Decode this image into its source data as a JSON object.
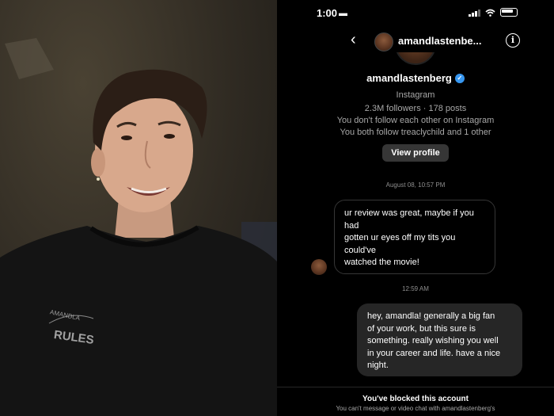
{
  "status_bar": {
    "time": "1:00",
    "car_icon": "car-icon",
    "signal_icon": "cellular-signal-icon",
    "wifi_icon": "wifi-icon",
    "battery_icon": "battery-icon"
  },
  "header": {
    "back_icon": "chevron-left-icon",
    "username": "amandlastenbe...",
    "info_icon": "info-icon"
  },
  "profile": {
    "username": "amandlastenberg",
    "verified_icon": "verified-badge-icon",
    "platform": "Instagram",
    "stats": "2.3M followers · 178 posts",
    "follow_status": "You don't follow each other on Instagram",
    "mutual": "You both follow treaclychild and 1 other",
    "view_profile_label": "View profile"
  },
  "messages": [
    {
      "timestamp": "August 08, 10:57 PM",
      "direction": "incoming",
      "lines": [
        "ur review was great, maybe if you",
        "had",
        "gotten ur eyes off my tits you",
        "could've",
        "watched the movie!"
      ]
    },
    {
      "timestamp": "12:59 AM",
      "direction": "outgoing",
      "lines": [
        "hey, amandla! generally a big fan",
        "of your work, but this sure is",
        "something. really wishing you well",
        "in your career and life. have a nice",
        "night."
      ]
    }
  ],
  "blocked_banner": {
    "title": "You've blocked this account",
    "subtitle": "You can't message or video chat with amandlastenberg's"
  },
  "photo": {
    "shirt_text": [
      "AMANDLA",
      "RULES"
    ]
  },
  "colors": {
    "background": "#000000",
    "outgoing_bubble": "#262626",
    "incoming_border": "#363636",
    "verified": "#3797f0",
    "secondary_text": "#a8a8a8"
  }
}
